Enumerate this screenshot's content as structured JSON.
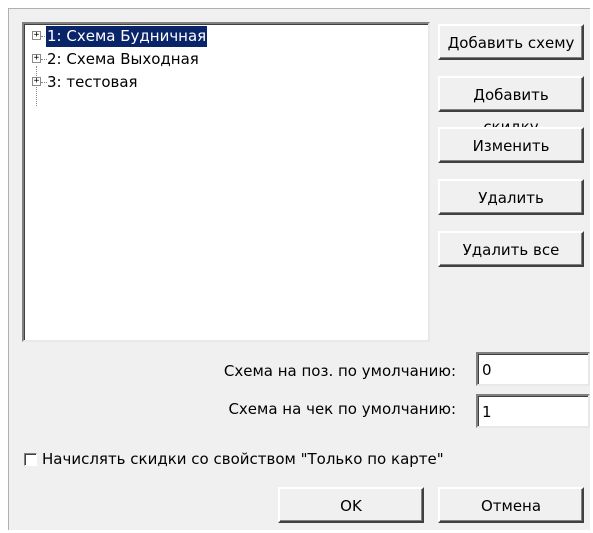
{
  "schemes": [
    {
      "label": "1: Схема Будничная",
      "selected": true
    },
    {
      "label": "2: Схема Выходная",
      "selected": false
    },
    {
      "label": "3: тестовая",
      "selected": false
    }
  ],
  "buttons": {
    "add_scheme": "Добавить схему",
    "add_discount": "Добавить скидку",
    "edit": "Изменить",
    "delete": "Удалить",
    "delete_all": "Удалить все"
  },
  "defaults": {
    "position_label": "Схема на поз. по умолчанию:",
    "position_value": "0",
    "receipt_label": "Схема на чек по умолчанию:",
    "receipt_value": "1"
  },
  "card_only_checkbox": {
    "label": "Начислять скидки со свойством \"Только по карте\"",
    "checked": false
  },
  "footer": {
    "ok": "OK",
    "cancel": "Отмена"
  },
  "colors": {
    "selection": "#0a246a",
    "dialog_bg": "#f0f0f0"
  }
}
